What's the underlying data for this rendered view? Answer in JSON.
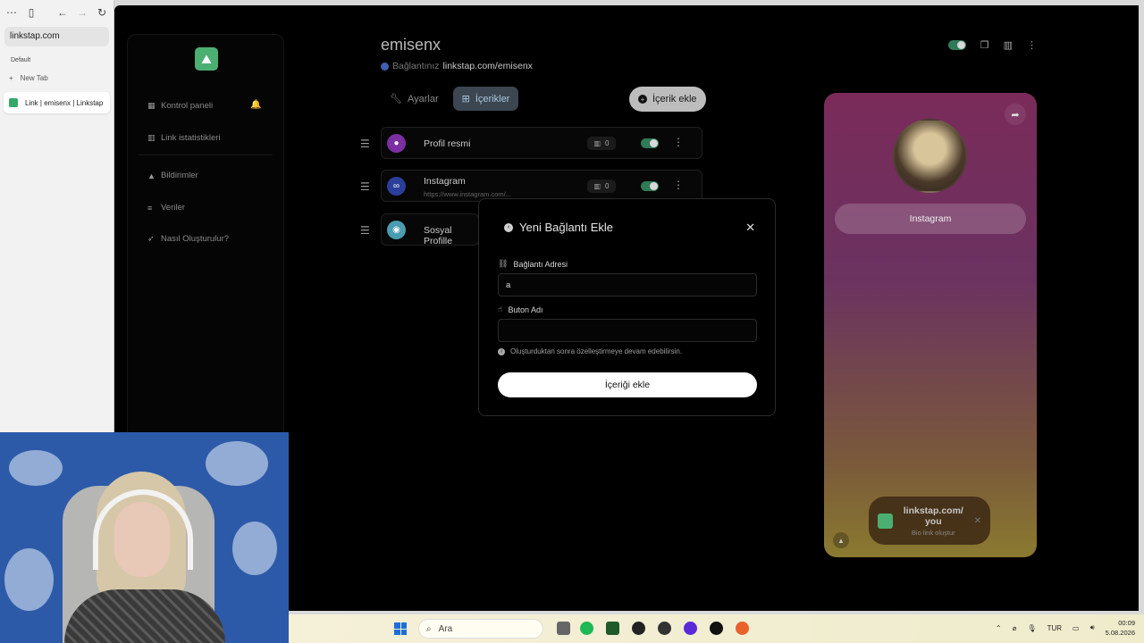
{
  "browser": {
    "url": "linkstap.com",
    "group_label": "Default",
    "new_tab_label": "New Tab",
    "active_tab_label": "Link | emisenx | Linkstap"
  },
  "nav": {
    "items": [
      {
        "label": "Kontrol paneli",
        "icon": "dashboard-icon"
      },
      {
        "label": "Link istatistikleri",
        "icon": "stats-icon"
      },
      {
        "label": "Bildirimler",
        "icon": "bell-icon"
      },
      {
        "label": "Veriler",
        "icon": "data-icon"
      },
      {
        "label": "Nasıl Oluşturulur?",
        "icon": "rocket-icon"
      }
    ]
  },
  "header": {
    "username": "emisenx",
    "link_prefix": "Bağlantınız",
    "link_url": "linkstap.com/emisenx"
  },
  "tabs": [
    {
      "label": "Ayarlar",
      "icon": "wrench-icon",
      "active": false
    },
    {
      "label": "İçerikler",
      "icon": "grid-icon",
      "active": true
    }
  ],
  "add_content_button": "İçerik ekle",
  "content_rows": [
    {
      "title": "Profil resmi",
      "subtitle": "",
      "count": "0",
      "enabled": true,
      "icon_color": "#7b2fa3"
    },
    {
      "title": "Instagram",
      "subtitle": "https://www.instagram.com/...",
      "count": "0",
      "enabled": true,
      "icon_color": "#2a3f9a"
    },
    {
      "title": "Sosyal Profille",
      "subtitle": "",
      "count": "",
      "enabled": true,
      "icon_color": "#4a9db0"
    }
  ],
  "modal": {
    "title": "Yeni Bağlantı Ekle",
    "link_label": "Bağlantı Adresi",
    "link_value": "a",
    "button_name_label": "Buton Adı",
    "button_name_value": "",
    "hint": "Oluşturduktan sonra özelleştirmeye devam edebilirsin.",
    "submit": "İçeriği ekle"
  },
  "preview": {
    "link_button": "Instagram",
    "badge_line1": "linkstap.com/",
    "badge_line2": "you",
    "badge_sub": "Bio link oluştur"
  },
  "taskbar": {
    "search_placeholder": "Ara",
    "lang": "TUR",
    "time": "00:09",
    "date": "5.08.2026"
  },
  "colors": {
    "accent_green": "#4caf72",
    "toggle_on": "#2f7a58",
    "tab_active_bg": "#3c4650"
  }
}
